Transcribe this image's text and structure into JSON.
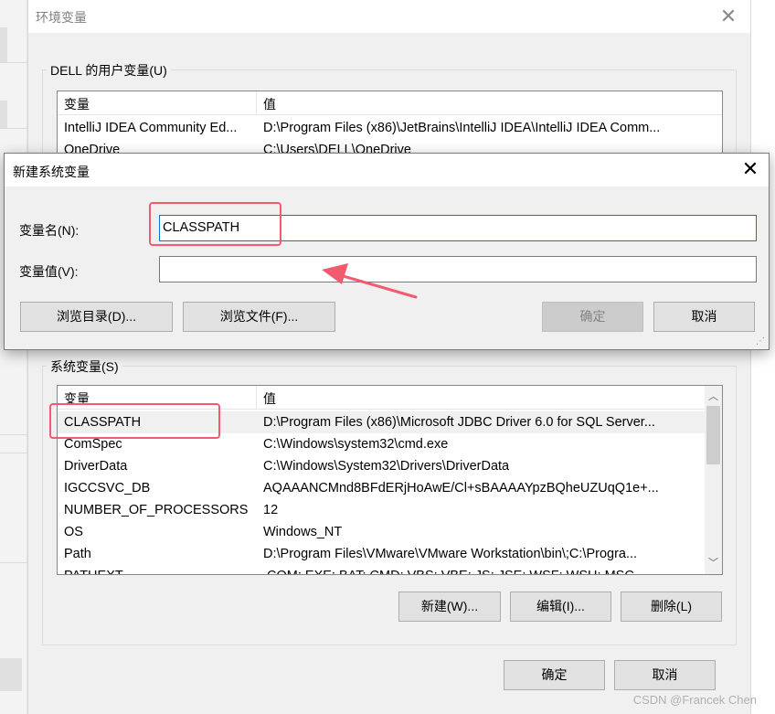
{
  "env_dialog": {
    "title": "环境变量",
    "user_group_label": "DELL 的用户变量(U)",
    "user_list": {
      "col_name": "变量",
      "col_value": "值",
      "rows": [
        {
          "name": "IntelliJ IDEA Community Ed...",
          "value": "D:\\Program Files (x86)\\JetBrains\\IntelliJ IDEA\\IntelliJ IDEA Comm..."
        },
        {
          "name": "OneDrive",
          "value": "C:\\Users\\DELL\\OneDrive"
        }
      ]
    },
    "system_group_label": "系统变量(S)",
    "system_list": {
      "col_name": "变量",
      "col_value": "值",
      "rows": [
        {
          "name": "CLASSPATH",
          "value": "D:\\Program Files (x86)\\Microsoft JDBC Driver 6.0 for SQL Server..."
        },
        {
          "name": "ComSpec",
          "value": "C:\\Windows\\system32\\cmd.exe"
        },
        {
          "name": "DriverData",
          "value": "C:\\Windows\\System32\\Drivers\\DriverData"
        },
        {
          "name": "IGCCSVC_DB",
          "value": "AQAAANCMnd8BFdERjHoAwE/Cl+sBAAAAYpzBQheUZUqQ1e+..."
        },
        {
          "name": "NUMBER_OF_PROCESSORS",
          "value": "12"
        },
        {
          "name": "OS",
          "value": "Windows_NT"
        },
        {
          "name": "Path",
          "value": "D:\\Program Files\\VMware\\VMware Workstation\\bin\\;C:\\Progra..."
        },
        {
          "name": "PATHEXT",
          "value": ".COM;.EXE;.BAT;.CMD;.VBS;.VBE;.JS;.JSE;.WSF;.WSH;.MSC"
        }
      ]
    },
    "buttons": {
      "new": "新建(W)...",
      "edit": "编辑(I)...",
      "delete": "删除(L)",
      "ok": "确定",
      "cancel": "取消"
    }
  },
  "new_var_dialog": {
    "title": "新建系统变量",
    "name_label": "变量名(N):",
    "name_value": "CLASSPATH",
    "value_label": "变量值(V):",
    "value_value": "",
    "buttons": {
      "browse_dir": "浏览目录(D)...",
      "browse_file": "浏览文件(F)...",
      "ok": "确定",
      "cancel": "取消"
    }
  },
  "annotation_color": "#f25a6e",
  "watermark": "CSDN @Francek Chen"
}
